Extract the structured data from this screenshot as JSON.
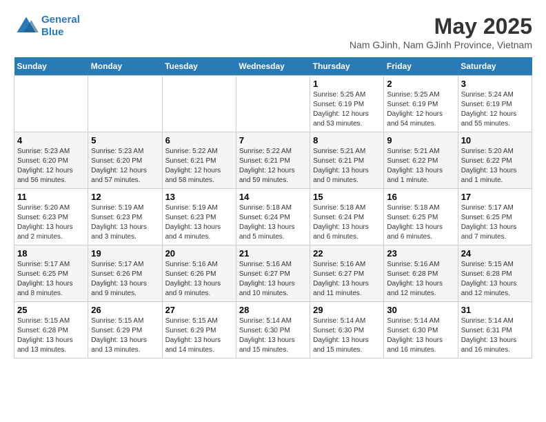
{
  "logo": {
    "line1": "General",
    "line2": "Blue"
  },
  "title": "May 2025",
  "subtitle": "Nam GJinh, Nam GJinh Province, Vietnam",
  "days_of_week": [
    "Sunday",
    "Monday",
    "Tuesday",
    "Wednesday",
    "Thursday",
    "Friday",
    "Saturday"
  ],
  "weeks": [
    [
      {
        "day": "",
        "content": ""
      },
      {
        "day": "",
        "content": ""
      },
      {
        "day": "",
        "content": ""
      },
      {
        "day": "",
        "content": ""
      },
      {
        "day": "1",
        "content": "Sunrise: 5:25 AM\nSunset: 6:19 PM\nDaylight: 12 hours\nand 53 minutes."
      },
      {
        "day": "2",
        "content": "Sunrise: 5:25 AM\nSunset: 6:19 PM\nDaylight: 12 hours\nand 54 minutes."
      },
      {
        "day": "3",
        "content": "Sunrise: 5:24 AM\nSunset: 6:19 PM\nDaylight: 12 hours\nand 55 minutes."
      }
    ],
    [
      {
        "day": "4",
        "content": "Sunrise: 5:23 AM\nSunset: 6:20 PM\nDaylight: 12 hours\nand 56 minutes."
      },
      {
        "day": "5",
        "content": "Sunrise: 5:23 AM\nSunset: 6:20 PM\nDaylight: 12 hours\nand 57 minutes."
      },
      {
        "day": "6",
        "content": "Sunrise: 5:22 AM\nSunset: 6:21 PM\nDaylight: 12 hours\nand 58 minutes."
      },
      {
        "day": "7",
        "content": "Sunrise: 5:22 AM\nSunset: 6:21 PM\nDaylight: 12 hours\nand 59 minutes."
      },
      {
        "day": "8",
        "content": "Sunrise: 5:21 AM\nSunset: 6:21 PM\nDaylight: 13 hours\nand 0 minutes."
      },
      {
        "day": "9",
        "content": "Sunrise: 5:21 AM\nSunset: 6:22 PM\nDaylight: 13 hours\nand 1 minute."
      },
      {
        "day": "10",
        "content": "Sunrise: 5:20 AM\nSunset: 6:22 PM\nDaylight: 13 hours\nand 1 minute."
      }
    ],
    [
      {
        "day": "11",
        "content": "Sunrise: 5:20 AM\nSunset: 6:23 PM\nDaylight: 13 hours\nand 2 minutes."
      },
      {
        "day": "12",
        "content": "Sunrise: 5:19 AM\nSunset: 6:23 PM\nDaylight: 13 hours\nand 3 minutes."
      },
      {
        "day": "13",
        "content": "Sunrise: 5:19 AM\nSunset: 6:23 PM\nDaylight: 13 hours\nand 4 minutes."
      },
      {
        "day": "14",
        "content": "Sunrise: 5:18 AM\nSunset: 6:24 PM\nDaylight: 13 hours\nand 5 minutes."
      },
      {
        "day": "15",
        "content": "Sunrise: 5:18 AM\nSunset: 6:24 PM\nDaylight: 13 hours\nand 6 minutes."
      },
      {
        "day": "16",
        "content": "Sunrise: 5:18 AM\nSunset: 6:25 PM\nDaylight: 13 hours\nand 6 minutes."
      },
      {
        "day": "17",
        "content": "Sunrise: 5:17 AM\nSunset: 6:25 PM\nDaylight: 13 hours\nand 7 minutes."
      }
    ],
    [
      {
        "day": "18",
        "content": "Sunrise: 5:17 AM\nSunset: 6:25 PM\nDaylight: 13 hours\nand 8 minutes."
      },
      {
        "day": "19",
        "content": "Sunrise: 5:17 AM\nSunset: 6:26 PM\nDaylight: 13 hours\nand 9 minutes."
      },
      {
        "day": "20",
        "content": "Sunrise: 5:16 AM\nSunset: 6:26 PM\nDaylight: 13 hours\nand 9 minutes."
      },
      {
        "day": "21",
        "content": "Sunrise: 5:16 AM\nSunset: 6:27 PM\nDaylight: 13 hours\nand 10 minutes."
      },
      {
        "day": "22",
        "content": "Sunrise: 5:16 AM\nSunset: 6:27 PM\nDaylight: 13 hours\nand 11 minutes."
      },
      {
        "day": "23",
        "content": "Sunrise: 5:16 AM\nSunset: 6:28 PM\nDaylight: 13 hours\nand 12 minutes."
      },
      {
        "day": "24",
        "content": "Sunrise: 5:15 AM\nSunset: 6:28 PM\nDaylight: 13 hours\nand 12 minutes."
      }
    ],
    [
      {
        "day": "25",
        "content": "Sunrise: 5:15 AM\nSunset: 6:28 PM\nDaylight: 13 hours\nand 13 minutes."
      },
      {
        "day": "26",
        "content": "Sunrise: 5:15 AM\nSunset: 6:29 PM\nDaylight: 13 hours\nand 13 minutes."
      },
      {
        "day": "27",
        "content": "Sunrise: 5:15 AM\nSunset: 6:29 PM\nDaylight: 13 hours\nand 14 minutes."
      },
      {
        "day": "28",
        "content": "Sunrise: 5:14 AM\nSunset: 6:30 PM\nDaylight: 13 hours\nand 15 minutes."
      },
      {
        "day": "29",
        "content": "Sunrise: 5:14 AM\nSunset: 6:30 PM\nDaylight: 13 hours\nand 15 minutes."
      },
      {
        "day": "30",
        "content": "Sunrise: 5:14 AM\nSunset: 6:30 PM\nDaylight: 13 hours\nand 16 minutes."
      },
      {
        "day": "31",
        "content": "Sunrise: 5:14 AM\nSunset: 6:31 PM\nDaylight: 13 hours\nand 16 minutes."
      }
    ]
  ]
}
